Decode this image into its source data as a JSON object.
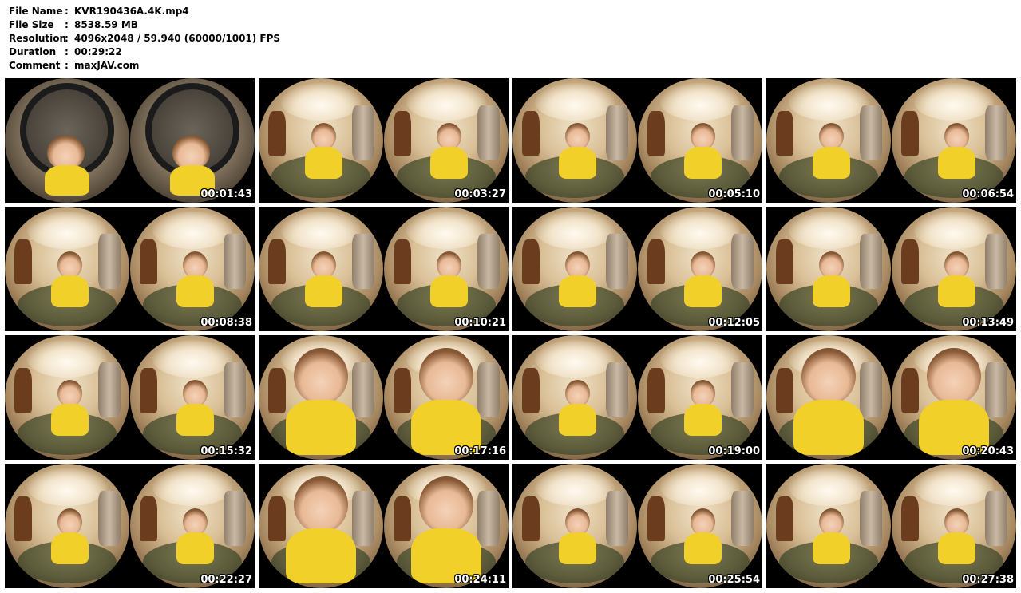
{
  "info": {
    "rows": [
      {
        "label": "File Name",
        "value": "KVR190436A.4K.mp4"
      },
      {
        "label": "File Size",
        "value": "8538.59 MB"
      },
      {
        "label": "Resolution",
        "value": "4096x2048 / 59.940 (60000/1001) FPS"
      },
      {
        "label": "Duration",
        "value": "00:29:22"
      },
      {
        "label": "Comment",
        "value": "maxJAV.com"
      }
    ],
    "separator": ":"
  },
  "thumbnails": [
    {
      "timestamp": "00:01:43",
      "scene": "mirror"
    },
    {
      "timestamp": "00:03:27",
      "scene": "room"
    },
    {
      "timestamp": "00:05:10",
      "scene": "room"
    },
    {
      "timestamp": "00:06:54",
      "scene": "room"
    },
    {
      "timestamp": "00:08:38",
      "scene": "room"
    },
    {
      "timestamp": "00:10:21",
      "scene": "room"
    },
    {
      "timestamp": "00:12:05",
      "scene": "room"
    },
    {
      "timestamp": "00:13:49",
      "scene": "room"
    },
    {
      "timestamp": "00:15:32",
      "scene": "room"
    },
    {
      "timestamp": "00:17:16",
      "scene": "close"
    },
    {
      "timestamp": "00:19:00",
      "scene": "room"
    },
    {
      "timestamp": "00:20:43",
      "scene": "close"
    },
    {
      "timestamp": "00:22:27",
      "scene": "room"
    },
    {
      "timestamp": "00:24:11",
      "scene": "close"
    },
    {
      "timestamp": "00:25:54",
      "scene": "room"
    },
    {
      "timestamp": "00:27:38",
      "scene": "room"
    }
  ]
}
